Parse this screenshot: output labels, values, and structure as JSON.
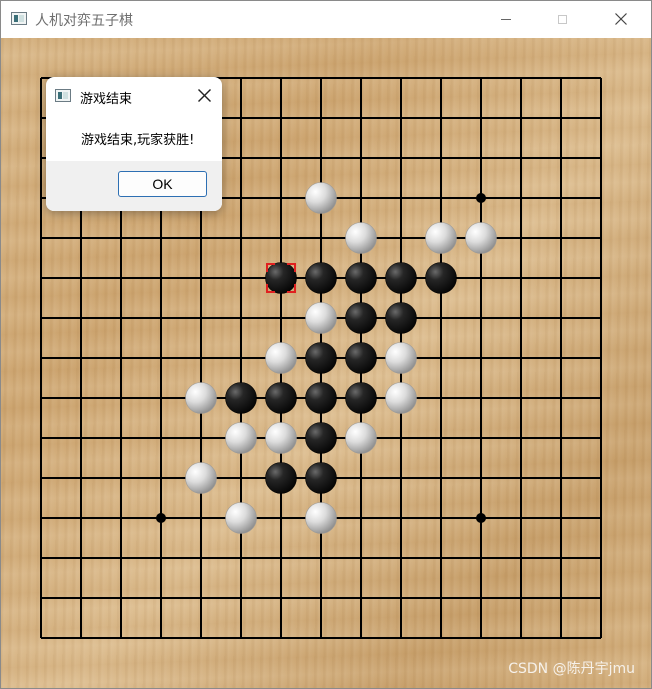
{
  "window": {
    "title": "人机对弈五子棋",
    "icon": "app-window-icon",
    "controls": [
      "minimize-icon",
      "maximize-icon",
      "close-icon"
    ]
  },
  "board": {
    "size": 15,
    "star_points": [
      [
        3,
        11
      ],
      [
        11,
        11
      ],
      [
        3,
        3
      ],
      [
        11,
        3
      ]
    ],
    "stones": [
      {
        "color": "white",
        "col": 7,
        "row": 3
      },
      {
        "color": "white",
        "col": 8,
        "row": 4
      },
      {
        "color": "white",
        "col": 10,
        "row": 4
      },
      {
        "color": "white",
        "col": 11,
        "row": 4
      },
      {
        "color": "black",
        "col": 6,
        "row": 5
      },
      {
        "color": "black",
        "col": 7,
        "row": 5
      },
      {
        "color": "black",
        "col": 8,
        "row": 5
      },
      {
        "color": "black",
        "col": 9,
        "row": 5
      },
      {
        "color": "black",
        "col": 10,
        "row": 5
      },
      {
        "color": "white",
        "col": 7,
        "row": 6
      },
      {
        "color": "black",
        "col": 8,
        "row": 6
      },
      {
        "color": "black",
        "col": 9,
        "row": 6
      },
      {
        "color": "white",
        "col": 6,
        "row": 7
      },
      {
        "color": "black",
        "col": 7,
        "row": 7
      },
      {
        "color": "black",
        "col": 8,
        "row": 7
      },
      {
        "color": "white",
        "col": 9,
        "row": 7
      },
      {
        "color": "white",
        "col": 4,
        "row": 8
      },
      {
        "color": "black",
        "col": 5,
        "row": 8
      },
      {
        "color": "black",
        "col": 6,
        "row": 8
      },
      {
        "color": "black",
        "col": 7,
        "row": 8
      },
      {
        "color": "black",
        "col": 8,
        "row": 8
      },
      {
        "color": "white",
        "col": 9,
        "row": 8
      },
      {
        "color": "white",
        "col": 5,
        "row": 9
      },
      {
        "color": "white",
        "col": 6,
        "row": 9
      },
      {
        "color": "black",
        "col": 7,
        "row": 9
      },
      {
        "color": "white",
        "col": 8,
        "row": 9
      },
      {
        "color": "white",
        "col": 4,
        "row": 10
      },
      {
        "color": "black",
        "col": 6,
        "row": 10
      },
      {
        "color": "black",
        "col": 7,
        "row": 10
      },
      {
        "color": "white",
        "col": 5,
        "row": 11
      },
      {
        "color": "white",
        "col": 7,
        "row": 11
      }
    ],
    "last_move": {
      "col": 6,
      "row": 5
    },
    "last_move_color": "#e02020",
    "line_color": "#000000"
  },
  "dialog": {
    "title": "游戏结束",
    "message": "游戏结束,玩家获胜!",
    "ok_label": "OK",
    "accent": "#2d6fb3"
  },
  "watermark": "CSDN @陈丹宇jmu"
}
